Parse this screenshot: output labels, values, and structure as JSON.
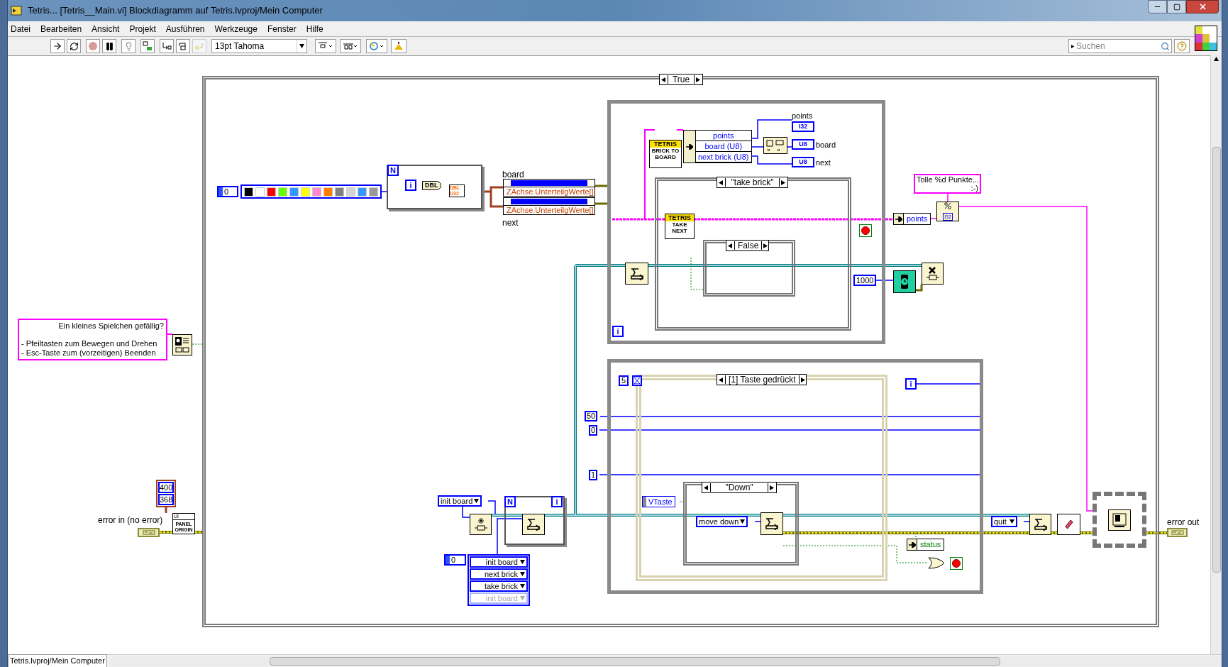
{
  "window": {
    "title": "Tetris... [Tetris__Main.vi] Blockdiagramm auf Tetris.lvproj/Mein Computer"
  },
  "menu": [
    "Datei",
    "Bearbeiten",
    "Ansicht",
    "Projekt",
    "Ausführen",
    "Werkzeuge",
    "Fenster",
    "Hilfe"
  ],
  "toolbar": {
    "font": "13pt Tahoma",
    "search_placeholder": "Suchen"
  },
  "diagram": {
    "case_selector": "True",
    "comment": {
      "title": "Ein kleines Spielchen gefällig?",
      "lines": [
        "- Pfeiltasten zum Bewegen und Drehen",
        "- Esc-Taste zum (vorzeitigen) Beenden"
      ]
    },
    "panel_origin": {
      "values": [
        "400",
        "368"
      ],
      "tag": "UI",
      "text": "PANEL ORIGIN"
    },
    "error_in": "error in (no error)",
    "color_array": {
      "index": "0",
      "colors": [
        {
          "color": "#000000"
        },
        {
          "color": "#ffffff"
        },
        {
          "color": "#ff0000"
        },
        {
          "color": "#66ff00"
        },
        {
          "color": "#3399ff"
        },
        {
          "color": "#ffff00"
        },
        {
          "color": "#ff88cc"
        },
        {
          "color": "#ff7f00"
        },
        {
          "color": "#808080"
        },
        {
          "color": "#d3d3d3"
        },
        {
          "color": "#3399ff"
        },
        {
          "color": "#999999"
        }
      ]
    },
    "for_loop": {
      "count": "N",
      "index": "i",
      "conversion": "DBL",
      "types": [
        "DBL",
        "U32"
      ]
    },
    "graph_refs": {
      "top_label": "board",
      "properties": [
        "ZAchse.UnterteilgWerte[]",
        "ZAchse.UnterteilgWerte[]"
      ],
      "bottom_label": "next"
    },
    "brick_to_board": {
      "tag": "TETRIS",
      "text": "BRICK TO BOARD"
    },
    "unbundle": [
      "points",
      "board (U8)",
      "next brick (U8)"
    ],
    "indicators": [
      {
        "kind": "top",
        "label": "points",
        "type": "I32"
      },
      {
        "kind": "right",
        "label": "board",
        "type": "U8"
      },
      {
        "kind": "right",
        "label": "next",
        "type": "U8"
      }
    ],
    "take_case": "\"take brick\"",
    "take_next": {
      "tag": "TETRIS",
      "text": "TAKE NEXT"
    },
    "false_case": "False",
    "wait_ms": "1000",
    "loop_index": "i",
    "format_string": [
      "Tolle %d Punkte...",
      ":-)"
    ],
    "points_bundle": {
      "label": "points",
      "type": "I32"
    },
    "event": {
      "timeout": "5",
      "selector": "[1] Taste gedrückt",
      "index": "i",
      "shift_values": [
        "50",
        "0",
        "1"
      ],
      "vkey": "VTaste",
      "down_case": "\"Down\"",
      "move": "move down",
      "status": "status"
    },
    "init": {
      "enum": "init board",
      "count": "N",
      "index": "i",
      "array_index": "0",
      "items": [
        {
          "label": "init board",
          "disabled": false
        },
        {
          "label": "next brick",
          "disabled": false
        },
        {
          "label": "take brick",
          "disabled": false
        },
        {
          "label": "init board",
          "disabled": true
        }
      ]
    },
    "quit": "quit",
    "error_out": "error out"
  },
  "status_bar": {
    "path": "Tetris.lvproj/Mein Computer"
  }
}
